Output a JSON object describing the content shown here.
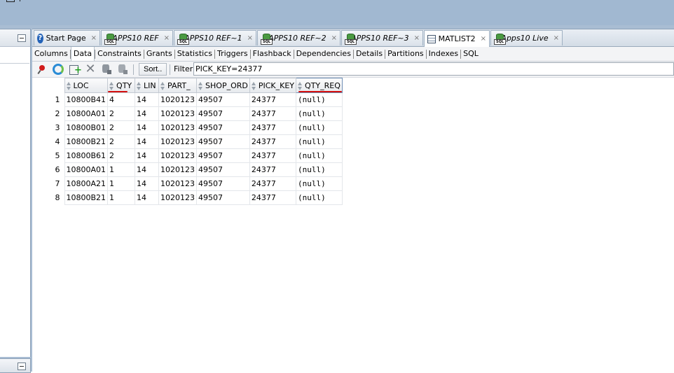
{
  "tabs": [
    {
      "label": "Start Page",
      "icon": "help-icon",
      "italic": false
    },
    {
      "label": "APPS10 REF",
      "icon": "sql-worksheet-icon",
      "italic": true
    },
    {
      "label": "APPS10 REF~1",
      "icon": "sql-worksheet-icon",
      "italic": true
    },
    {
      "label": "APPS10 REF~2",
      "icon": "sql-worksheet-icon",
      "italic": true
    },
    {
      "label": "APPS10 REF~3",
      "icon": "sql-worksheet-icon",
      "italic": true
    },
    {
      "label": "MATLIST2",
      "icon": "table-icon",
      "italic": false,
      "active": true
    },
    {
      "label": "Apps10 Live",
      "icon": "sql-worksheet-icon",
      "italic": true
    }
  ],
  "sql_icon_text": "SQL",
  "close_glyph": "×",
  "help_glyph": "?",
  "subtabs": [
    "Columns",
    "Data",
    "Constraints",
    "Grants",
    "Statistics",
    "Triggers",
    "Flashback",
    "Dependencies",
    "Details",
    "Partitions",
    "Indexes",
    "SQL"
  ],
  "active_subtab": "Data",
  "toolbar": {
    "icons": [
      "pin-icon",
      "refresh-icon",
      "insert-row-icon",
      "delete-row-icon",
      "commit-icon",
      "rollback-icon"
    ],
    "sort_label": "Sort..",
    "filter_label": "Filter:",
    "filter_value": "PICK_KEY=24377"
  },
  "grid": {
    "columns": [
      "LOC",
      "QTY",
      "LIN",
      "PART_",
      "SHOP_ORD",
      "PICK_KEY",
      "QTY_REQ"
    ],
    "rows": [
      [
        "1",
        "10800B41",
        "4",
        "14",
        "1020123",
        "49507",
        "24377",
        "(null)"
      ],
      [
        "2",
        "10800A01",
        "2",
        "14",
        "1020123",
        "49507",
        "24377",
        "(null)"
      ],
      [
        "3",
        "10800B01",
        "2",
        "14",
        "1020123",
        "49507",
        "24377",
        "(null)"
      ],
      [
        "4",
        "10800B21",
        "2",
        "14",
        "1020123",
        "49507",
        "24377",
        "(null)"
      ],
      [
        "5",
        "10800B61",
        "2",
        "14",
        "1020123",
        "49507",
        "24377",
        "(null)"
      ],
      [
        "6",
        "10800A01",
        "1",
        "14",
        "1020123",
        "49507",
        "24377",
        "(null)"
      ],
      [
        "7",
        "10800A21",
        "1",
        "14",
        "1020123",
        "49507",
        "24377",
        "(null)"
      ],
      [
        "8",
        "10800B21",
        "1",
        "14",
        "1020123",
        "49507",
        "24377",
        "(null)"
      ]
    ],
    "highlighted_columns": [
      "QTY",
      "QTY_REQ"
    ],
    "annotation_color": "#d40f0f"
  }
}
